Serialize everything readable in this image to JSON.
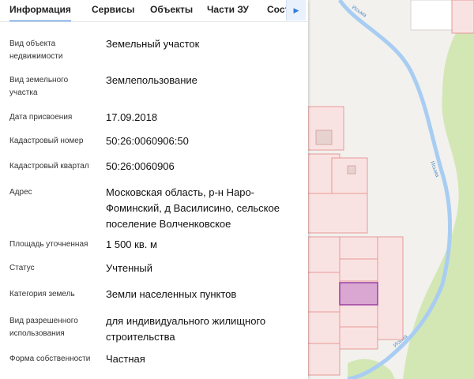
{
  "tabs": [
    {
      "label": "Информация",
      "active": true
    },
    {
      "label": "Сервисы",
      "active": false
    },
    {
      "label": "Объекты",
      "active": false
    },
    {
      "label": "Части ЗУ",
      "active": false
    },
    {
      "label": "Сост",
      "active": false
    }
  ],
  "tab_scroll_icon": "chevron-right-icon",
  "fields": [
    {
      "label": "Вид объекта недвижимости",
      "value": "Земельный участок"
    },
    {
      "label": "Вид земельного участка",
      "value": "Землепользование"
    },
    {
      "label": "Дата присвоения",
      "value": "17.09.2018"
    },
    {
      "label": "Кадастровый номер",
      "value": "50:26:0060906:50"
    },
    {
      "label": "Кадастровый квартал",
      "value": "50:26:0060906"
    },
    {
      "label": "Адрес",
      "value": "Московская область, р-н Наро-Фоминский, д Василисино, сельское поселение Волченковское"
    },
    {
      "label": "Площадь уточненная",
      "value": "1 500 кв. м"
    },
    {
      "label": "Статус",
      "value": "Учтенный"
    },
    {
      "label": "Категория земель",
      "value": "Земли населенных пунктов"
    },
    {
      "label": "Вид разрешенного использования",
      "value": "для индивидуального жилищного строительства"
    },
    {
      "label": "Форма собственности",
      "value": "Частная"
    }
  ],
  "map": {
    "river_label": "Исьма",
    "colors": {
      "river": "#a9cdf2",
      "parcel_border": "#e79a98",
      "parcel_fill": "#f9e3e2",
      "selected_fill": "#d9a7d2",
      "selected_border": "#9b3fa0",
      "forest": "#d3e7b4",
      "tab_accent": "#2f7de1"
    }
  }
}
